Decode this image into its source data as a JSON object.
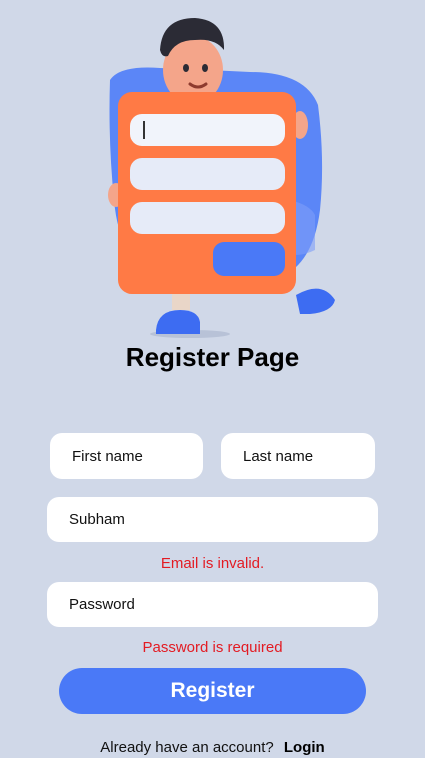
{
  "page": {
    "title": "Register Page"
  },
  "form": {
    "first_name": {
      "placeholder": "First name"
    },
    "last_name": {
      "placeholder": "Last name"
    },
    "email": {
      "value": "Subham",
      "error": "Email is invalid."
    },
    "password": {
      "placeholder": "Password",
      "error": "Password is required"
    },
    "submit_label": "Register"
  },
  "footer": {
    "prompt": "Already have an account?",
    "link_label": "Login"
  },
  "colors": {
    "background": "#d0d8e8",
    "accent": "#4a79f7",
    "error": "#e31b23",
    "illustration_card": "#ff7a45"
  },
  "illustration": {
    "icon": "register-character-illustration"
  }
}
